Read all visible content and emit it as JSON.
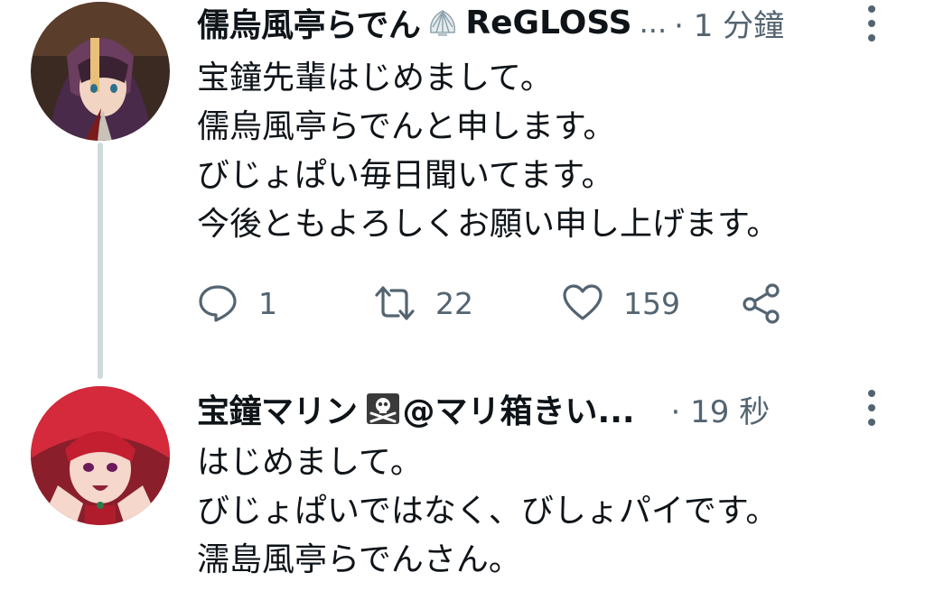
{
  "tweets": [
    {
      "name": "儒烏風亭らでん",
      "handle": "ReGLOSS",
      "ellipsis": "...",
      "time": "· 1 分鐘",
      "badge_icon": "seashell-icon",
      "lines": [
        "宝鐘先輩はじめまして。",
        "儒烏風亭らでんと申します。",
        "びじょぱい毎日聞いてます。",
        "今後ともよろしくお願い申し上げます。"
      ],
      "actions": {
        "reply_count": "1",
        "retweet_count": "22",
        "like_count": "159"
      }
    },
    {
      "name": "宝鐘マリン",
      "handle": "@マリ箱きい...",
      "time": "· 19 秒",
      "badge_icon": "skull-crossbones-icon",
      "lines": [
        "はじめまして。",
        "びじょぱいではなく、びしょパイです。",
        "濡島風亭らでんさん。"
      ]
    }
  ],
  "colors": {
    "text": "#0f1419",
    "secondary": "#536471",
    "thread_line": "#cfd9de",
    "background": "#ffffff"
  }
}
